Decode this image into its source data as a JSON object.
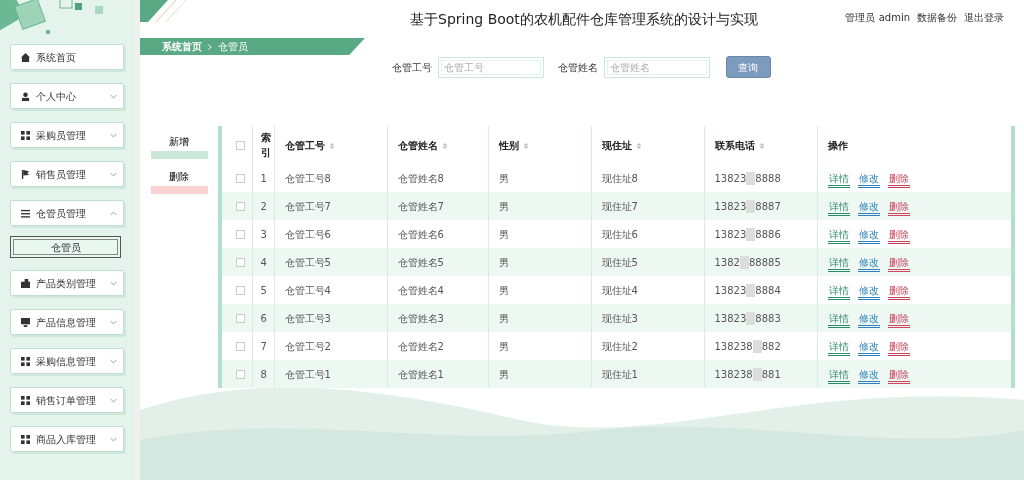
{
  "title": "基于Spring Boot的农机配件仓库管理系统的设计与实现",
  "user_bar": [
    "管理员 admin",
    "数据备份",
    "退出登录"
  ],
  "sidebar": {
    "items": [
      {
        "label": "系统首页"
      },
      {
        "label": "个人中心",
        "expanded": false
      },
      {
        "label": "采购员管理",
        "expanded": false
      },
      {
        "label": "销售员管理",
        "expanded": false
      },
      {
        "label": "仓管员管理",
        "expanded": true,
        "children": [
          {
            "label": "仓管员",
            "selected": true
          }
        ]
      },
      {
        "label": "产品类别管理",
        "expanded": false
      },
      {
        "label": "产品信息管理",
        "expanded": false
      },
      {
        "label": "采购信息管理",
        "expanded": false
      },
      {
        "label": "销售订单管理",
        "expanded": false
      },
      {
        "label": "商品入库管理",
        "expanded": false
      }
    ]
  },
  "breadcrumb": [
    "系统首页",
    "仓管员"
  ],
  "search": {
    "fields": [
      {
        "label": "仓管工号",
        "placeholder": "仓管工号"
      },
      {
        "label": "仓管姓名",
        "placeholder": "仓管姓名"
      }
    ],
    "button": "查询"
  },
  "actions": [
    "新增",
    "删除"
  ],
  "table": {
    "header_checked": false,
    "columns": [
      {
        "label": "索引",
        "sortable": false
      },
      {
        "label": "仓管工号",
        "sortable": true
      },
      {
        "label": "仓管姓名",
        "sortable": true
      },
      {
        "label": "性别",
        "sortable": true
      },
      {
        "label": "现住址",
        "sortable": true
      },
      {
        "label": "联系电话",
        "sortable": true
      },
      {
        "label": "操作",
        "sortable": false
      }
    ],
    "rows": [
      {
        "checked": false,
        "index": "1",
        "id": "仓管工号8",
        "name": "仓管姓名8",
        "gender": "男",
        "address": "现住址8",
        "phone_head": "13823",
        "phone_tail": "8888",
        "actions": [
          {
            "label": "详情",
            "color": "#2e8b6a"
          },
          {
            "label": "修改",
            "color": "#2f7fb8"
          },
          {
            "label": "删除",
            "color": "#c8455a"
          }
        ]
      },
      {
        "checked": false,
        "index": "2",
        "id": "仓管工号7",
        "name": "仓管姓名7",
        "gender": "男",
        "address": "现住址7",
        "phone_head": "13823",
        "phone_tail": "8887",
        "actions": [
          {
            "label": "详情",
            "color": "#2e8b6a"
          },
          {
            "label": "修改",
            "color": "#2f7fb8"
          },
          {
            "label": "删除",
            "color": "#c8455a"
          }
        ]
      },
      {
        "checked": false,
        "index": "3",
        "id": "仓管工号6",
        "name": "仓管姓名6",
        "gender": "男",
        "address": "现住址6",
        "phone_head": "13823",
        "phone_tail": "8886",
        "actions": [
          {
            "label": "详情",
            "color": "#2e8b6a"
          },
          {
            "label": "修改",
            "color": "#2f7fb8"
          },
          {
            "label": "删除",
            "color": "#c8455a"
          }
        ]
      },
      {
        "checked": false,
        "index": "4",
        "id": "仓管工号5",
        "name": "仓管姓名5",
        "gender": "男",
        "address": "现住址5",
        "phone_head": "1382",
        "phone_tail": "88885",
        "actions": [
          {
            "label": "详情",
            "color": "#2e8b6a"
          },
          {
            "label": "修改",
            "color": "#2f7fb8"
          },
          {
            "label": "删除",
            "color": "#c8455a"
          }
        ]
      },
      {
        "checked": false,
        "index": "5",
        "id": "仓管工号4",
        "name": "仓管姓名4",
        "gender": "男",
        "address": "现住址4",
        "phone_head": "13823",
        "phone_tail": "8884",
        "actions": [
          {
            "label": "详情",
            "color": "#2e8b6a"
          },
          {
            "label": "修改",
            "color": "#2f7fb8"
          },
          {
            "label": "删除",
            "color": "#c8455a"
          }
        ]
      },
      {
        "checked": false,
        "index": "6",
        "id": "仓管工号3",
        "name": "仓管姓名3",
        "gender": "男",
        "address": "现住址3",
        "phone_head": "13823",
        "phone_tail": "8883",
        "actions": [
          {
            "label": "详情",
            "color": "#2e8b6a"
          },
          {
            "label": "修改",
            "color": "#2f7fb8"
          },
          {
            "label": "删除",
            "color": "#c8455a"
          }
        ]
      },
      {
        "checked": false,
        "index": "7",
        "id": "仓管工号2",
        "name": "仓管姓名2",
        "gender": "男",
        "address": "现住址2",
        "phone_head": "138238",
        "phone_tail": "882",
        "actions": [
          {
            "label": "详情",
            "color": "#2e8b6a"
          },
          {
            "label": "修改",
            "color": "#2f7fb8"
          },
          {
            "label": "删除",
            "color": "#c8455a"
          }
        ]
      },
      {
        "checked": false,
        "index": "8",
        "id": "仓管工号1",
        "name": "仓管姓名1",
        "gender": "男",
        "address": "现住址1",
        "phone_head": "138238",
        "phone_tail": "881",
        "actions": [
          {
            "label": "详情",
            "color": "#2e8b6a"
          },
          {
            "label": "修改",
            "color": "#2f7fb8"
          },
          {
            "label": "删除",
            "color": "#c8455a"
          }
        ]
      }
    ]
  }
}
